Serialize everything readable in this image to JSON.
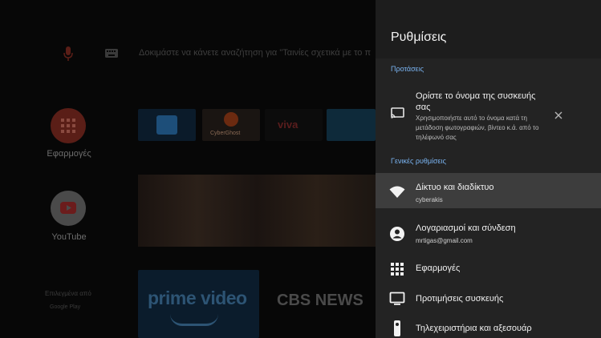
{
  "background": {
    "search_placeholder": "Δοκιμάστε να κάνετε αναζήτηση για \"Ταινίες σχετικά με το π",
    "apps_label": "Εφαρμογές",
    "youtube_label": "YouTube",
    "featured_by": "Επιλεγμένα από",
    "google_play": "Google Play",
    "tile_cyberghost": "CyberGhost",
    "tile_viva": "viva",
    "prime_video": "prime video",
    "cbs_news": "CBS NEWS"
  },
  "settings": {
    "title": "Ρυθμίσεις",
    "suggestions_header": "Προτάσεις",
    "suggestion": {
      "title": "Ορίστε το όνομα της συσκευής σας",
      "description": "Χρησιμοποιήστε αυτό το όνομα κατά τη μετάδοση φωτογραφιών, βίντεο κ.ά. από το τηλέφωνό σας"
    },
    "general_header": "Γενικές ρυθμίσεις",
    "items": [
      {
        "label": "Δίκτυο και διαδίκτυο",
        "sublabel": "cyberakis",
        "icon": "wifi-icon"
      },
      {
        "label": "Λογαριασμοί και σύνδεση",
        "sublabel": "mrtigas@gmail.com",
        "icon": "account-icon"
      },
      {
        "label": "Εφαρμογές",
        "icon": "apps-grid-icon"
      },
      {
        "label": "Προτιμήσεις συσκευής",
        "icon": "tv-icon"
      },
      {
        "label": "Τηλεχειριστήρια και αξεσουάρ",
        "icon": "remote-icon"
      }
    ]
  },
  "colors": {
    "accent": "#7ab4f2",
    "panel_bg": "#232323",
    "selected_bg": "#3d3d3d"
  }
}
